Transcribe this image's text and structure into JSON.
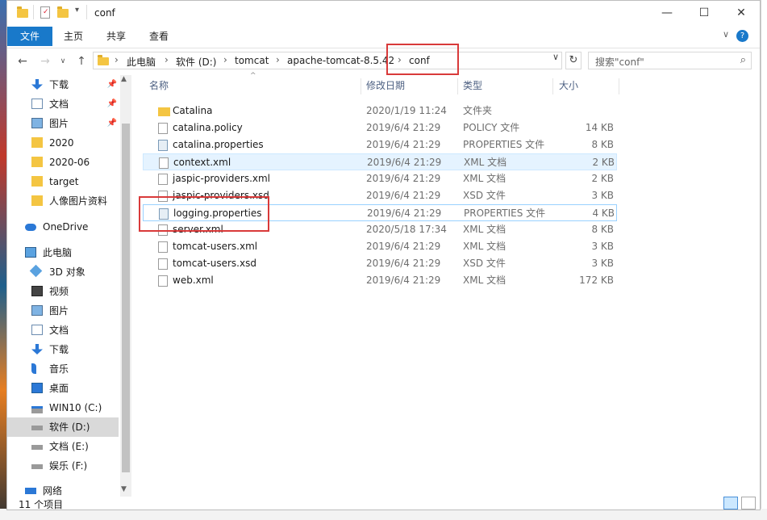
{
  "window": {
    "title": "conf"
  },
  "ribbon": {
    "tabs": [
      "文件",
      "主页",
      "共享",
      "查看"
    ]
  },
  "address": {
    "breadcrumbs": [
      "此电脑",
      "软件 (D:)",
      "tomcat",
      "apache-tomcat-8.5.42",
      "conf"
    ]
  },
  "search": {
    "placeholder": "搜索\"conf\""
  },
  "nav": {
    "items": [
      {
        "label": "下载",
        "icon": "download-icon",
        "pinned": true
      },
      {
        "label": "文档",
        "icon": "document-icon",
        "pinned": true
      },
      {
        "label": "图片",
        "icon": "picture-icon",
        "pinned": true
      },
      {
        "label": "2020",
        "icon": "folder-icon",
        "pinned": false
      },
      {
        "label": "2020-06",
        "icon": "folder-icon",
        "pinned": false
      },
      {
        "label": "target",
        "icon": "folder-icon",
        "pinned": false
      },
      {
        "label": "人像图片资料",
        "icon": "folder-icon",
        "pinned": false
      },
      {
        "label": "OneDrive",
        "icon": "cloud-icon",
        "pinned": false
      },
      {
        "label": "此电脑",
        "icon": "computer-icon",
        "pinned": false
      },
      {
        "label": "3D 对象",
        "icon": "3d-objects-icon",
        "pinned": false
      },
      {
        "label": "视频",
        "icon": "video-icon",
        "pinned": false
      },
      {
        "label": "图片",
        "icon": "picture-icon",
        "pinned": false
      },
      {
        "label": "文档",
        "icon": "document-icon",
        "pinned": false
      },
      {
        "label": "下载",
        "icon": "download-icon",
        "pinned": false
      },
      {
        "label": "音乐",
        "icon": "music-icon",
        "pinned": false
      },
      {
        "label": "桌面",
        "icon": "desktop-icon",
        "pinned": false
      },
      {
        "label": "WIN10 (C:)",
        "icon": "system-drive-icon",
        "pinned": false
      },
      {
        "label": "软件 (D:)",
        "icon": "drive-icon",
        "pinned": false,
        "selected": true
      },
      {
        "label": "文档 (E:)",
        "icon": "drive-icon",
        "pinned": false
      },
      {
        "label": "娱乐 (F:)",
        "icon": "drive-icon",
        "pinned": false
      },
      {
        "label": "网络",
        "icon": "network-icon",
        "pinned": false
      }
    ]
  },
  "columns": {
    "name": "名称",
    "date": "修改日期",
    "type": "类型",
    "size": "大小"
  },
  "files": [
    {
      "name": "Catalina",
      "date": "2020/1/19 11:24",
      "type": "文件夹",
      "size": "",
      "kind": "folder"
    },
    {
      "name": "catalina.policy",
      "date": "2019/6/4 21:29",
      "type": "POLICY 文件",
      "size": "14 KB",
      "kind": "file"
    },
    {
      "name": "catalina.properties",
      "date": "2019/6/4 21:29",
      "type": "PROPERTIES 文件",
      "size": "8 KB",
      "kind": "prop"
    },
    {
      "name": "context.xml",
      "date": "2019/6/4 21:29",
      "type": "XML 文档",
      "size": "2 KB",
      "kind": "file"
    },
    {
      "name": "jaspic-providers.xml",
      "date": "2019/6/4 21:29",
      "type": "XML 文档",
      "size": "2 KB",
      "kind": "file"
    },
    {
      "name": "jaspic-providers.xsd",
      "date": "2019/6/4 21:29",
      "type": "XSD 文件",
      "size": "3 KB",
      "kind": "file"
    },
    {
      "name": "logging.properties",
      "date": "2019/6/4 21:29",
      "type": "PROPERTIES 文件",
      "size": "4 KB",
      "kind": "prop"
    },
    {
      "name": "server.xml",
      "date": "2020/5/18 17:34",
      "type": "XML 文档",
      "size": "8 KB",
      "kind": "file"
    },
    {
      "name": "tomcat-users.xml",
      "date": "2019/6/4 21:29",
      "type": "XML 文档",
      "size": "3 KB",
      "kind": "file"
    },
    {
      "name": "tomcat-users.xsd",
      "date": "2019/6/4 21:29",
      "type": "XSD 文件",
      "size": "3 KB",
      "kind": "file"
    },
    {
      "name": "web.xml",
      "date": "2019/6/4 21:29",
      "type": "XML 文档",
      "size": "172 KB",
      "kind": "file"
    }
  ],
  "status": {
    "count": "11 个项目"
  }
}
